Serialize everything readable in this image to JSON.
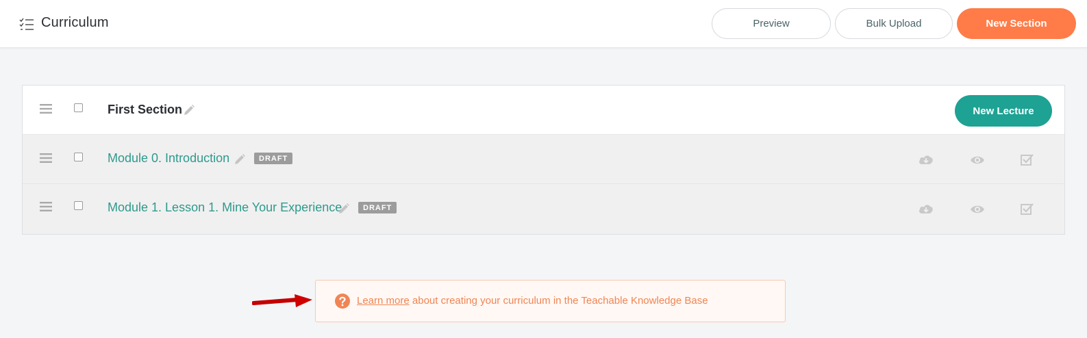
{
  "header": {
    "title": "Curriculum",
    "icon": "checklist-icon",
    "buttons": {
      "preview": "Preview",
      "bulk_upload": "Bulk Upload",
      "new_section": "New Section"
    }
  },
  "section": {
    "title": "First Section",
    "new_lecture_label": "New Lecture",
    "lectures": [
      {
        "title": "Module 0. Introduction",
        "badge": "DRAFT"
      },
      {
        "title": "Module 1. Lesson 1. Mine Your Experience",
        "badge": "DRAFT"
      }
    ]
  },
  "knowledge_base": {
    "link_text": "Learn more",
    "text": " about creating your curriculum in the Teachable Knowledge Base"
  },
  "colors": {
    "accent_orange": "#ff7b47",
    "accent_teal": "#1da293",
    "lecture_text": "#2e9a8c",
    "kb_text": "#f08554"
  }
}
